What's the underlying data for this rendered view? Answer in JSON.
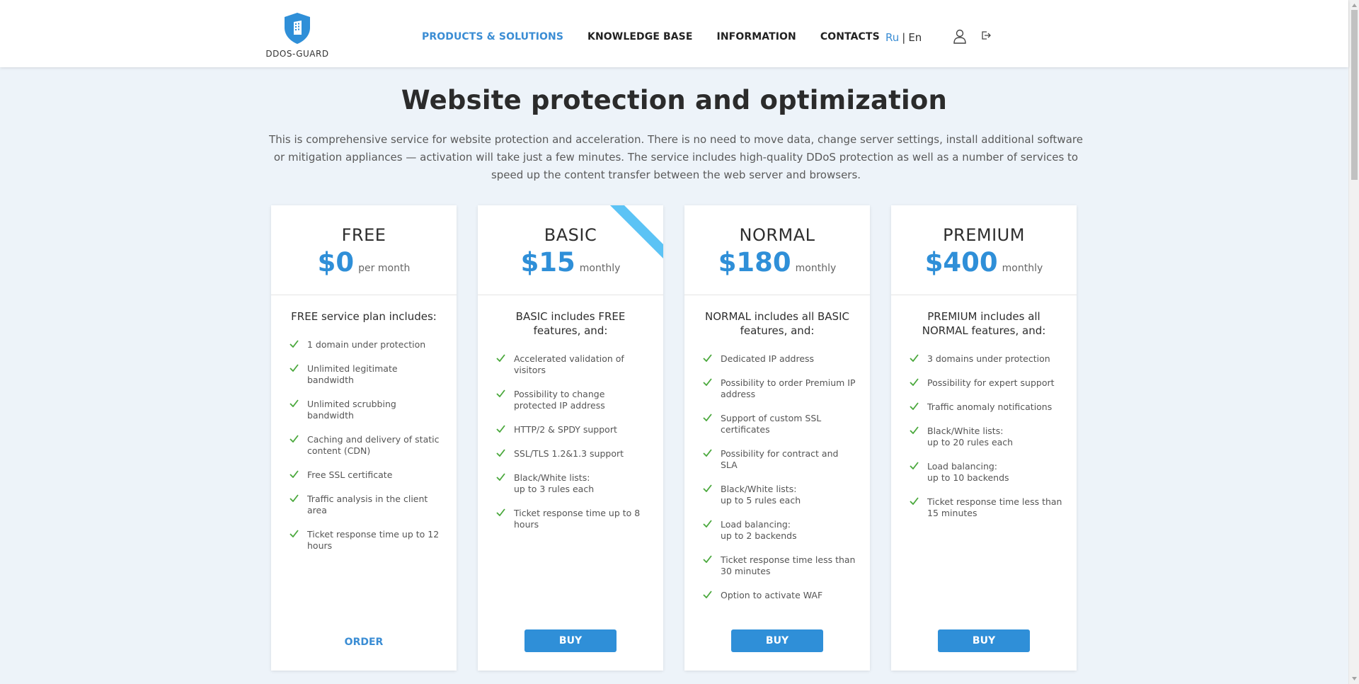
{
  "header": {
    "logo_text": "DDOS-GUARD",
    "nav": [
      {
        "label": "PRODUCTS & SOLUTIONS",
        "active": true
      },
      {
        "label": "KNOWLEDGE BASE",
        "active": false
      },
      {
        "label": "INFORMATION",
        "active": false
      },
      {
        "label": "CONTACTS",
        "active": false
      }
    ],
    "lang": {
      "ru": "Ru",
      "separator": "|",
      "en": "En"
    }
  },
  "hero": {
    "title": "Website protection and optimization",
    "description": "This is comprehensive service for website protection and acceleration. There is no need to move data, change server settings, install additional software or mitigation appliances — activation will take just a few minutes. The service includes high-quality DDoS protection as well as a number of services to speed up the content transfer between the web server and browsers."
  },
  "plans": [
    {
      "name": "FREE",
      "price": "$0",
      "period": "per month",
      "intro": "FREE service plan includes:",
      "features": [
        "1 domain under protection",
        "Unlimited legitimate bandwidth",
        "Unlimited scrubbing bandwidth",
        "Caching and delivery of static content (CDN)",
        "Free SSL certificate",
        "Traffic analysis in the client area",
        "Ticket response time up to 12 hours"
      ],
      "action": "ORDER"
    },
    {
      "name": "BASIC",
      "price": "$15",
      "period": "monthly",
      "intro": "BASIC includes FREE features, and:",
      "features": [
        "Accelerated validation of visitors",
        "Possibility to change protected IP address",
        "HTTP/2 & SPDY support",
        "SSL/TLS 1.2&1.3 support",
        "Black/White lists:\nup to 3 rules each",
        "Ticket response time up to 8 hours"
      ],
      "action": "BUY"
    },
    {
      "name": "NORMAL",
      "price": "$180",
      "period": "monthly",
      "intro": "NORMAL includes all BASIC features, and:",
      "features": [
        "Dedicated IP address",
        "Possibility to order Premium IP address",
        "Support of custom SSL certificates",
        "Possibility for contract and SLA",
        "Black/White lists:\nup to 5 rules each",
        "Load balancing:\nup to 2 backends",
        "Ticket response time less than 30 minutes",
        "Option to activate WAF"
      ],
      "action": "BUY"
    },
    {
      "name": "PREMIUM",
      "price": "$400",
      "period": "monthly",
      "intro": "PREMIUM includes all NORMAL features, and:",
      "features": [
        "3 domains under protection",
        "Possibility for expert support",
        "Traffic anomaly notifications",
        "Black/White lists:\nup to 20 rules each",
        "Load balancing:\nup to 10 backends",
        "Ticket response time less than 15 minutes"
      ],
      "action": "BUY"
    }
  ],
  "colors": {
    "accent": "#2f8fd8",
    "nav_active": "#3b8dd4",
    "check": "#4aa83c",
    "ribbon": "#5cc3f5",
    "page_bg": "#edf3f9"
  }
}
